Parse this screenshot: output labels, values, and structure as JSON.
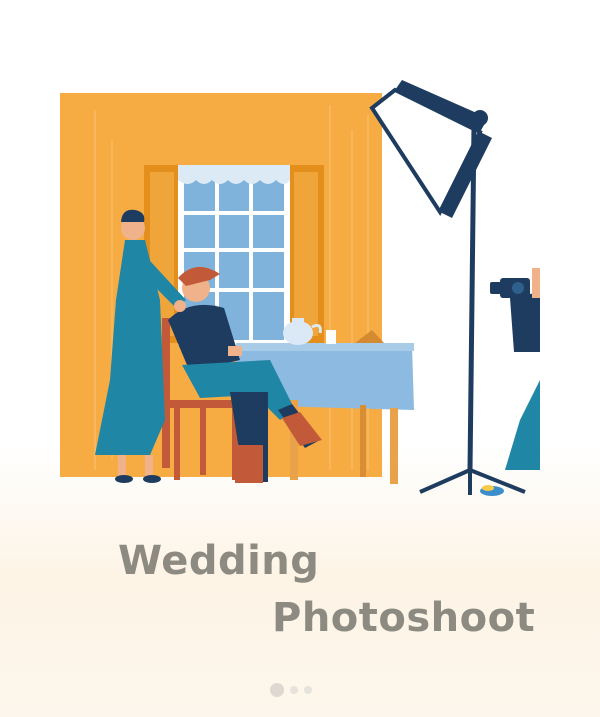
{
  "slide": {
    "title_line1": "Wedding",
    "title_line2": "Photoshoot"
  },
  "pager": {
    "count": 3,
    "active_index": 0
  },
  "colors": {
    "wall": "#f6ac42",
    "shutter": "#e48f1b",
    "window": "#7fb3dc",
    "tablecloth": "#8dbae0",
    "teal": "#1f86a5",
    "navy": "#1e3c5f",
    "title": "#8d8a82"
  },
  "illustration": {
    "description_icons": [
      "studio-light-icon",
      "camera-icon",
      "window-icon",
      "teapot-icon"
    ]
  }
}
